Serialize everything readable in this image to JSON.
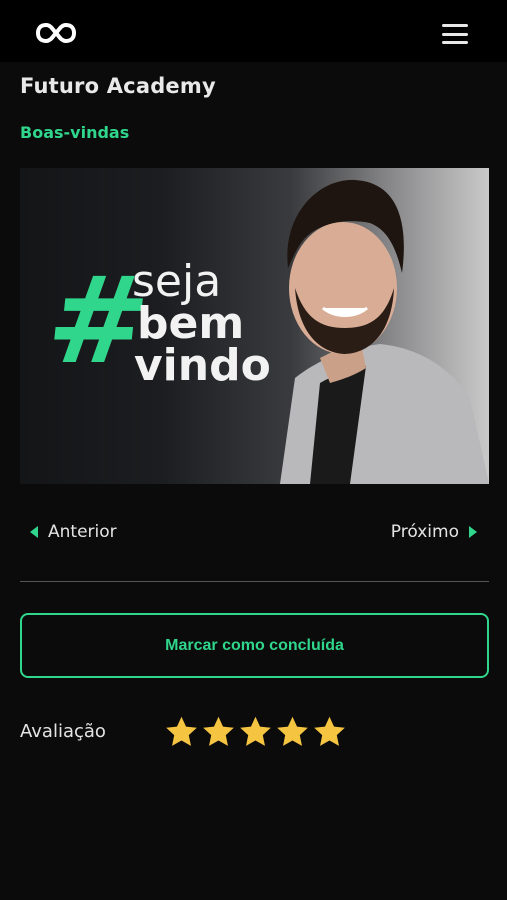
{
  "header": {
    "logo_icon": "infinity-logo-icon",
    "menu_icon": "hamburger-menu-icon"
  },
  "course": {
    "title": "Futuro Academy"
  },
  "lesson": {
    "title": "Boas-vindas"
  },
  "video": {
    "hashtag": "#",
    "line1": "seja",
    "line2": "bem",
    "line3": "vindo"
  },
  "navigation": {
    "prev_label": "Anterior",
    "next_label": "Próximo"
  },
  "actions": {
    "complete_label": "Marcar como concluída"
  },
  "rating": {
    "label": "Avaliação",
    "value": 5,
    "max": 5
  },
  "colors": {
    "accent": "#2fd68b",
    "background": "#0b0b0b",
    "star": "#f5c542"
  }
}
